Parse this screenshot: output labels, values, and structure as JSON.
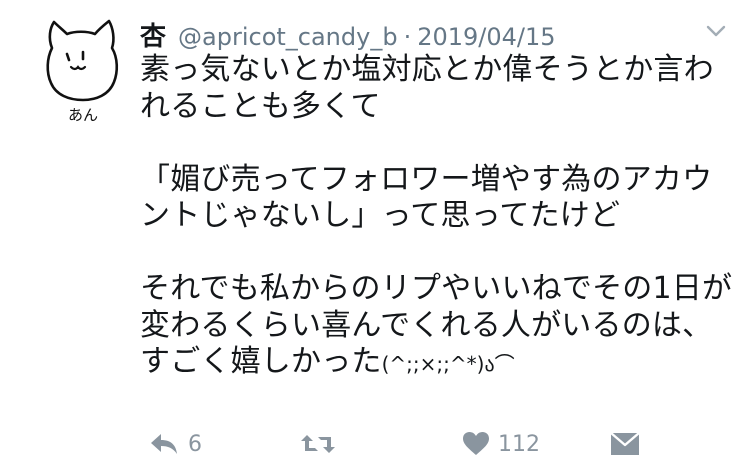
{
  "tweet": {
    "avatar_caption": "あん",
    "display_name": "杏",
    "handle": "@apricot_candy_b",
    "separator": "·",
    "date": "2019/04/15",
    "lines": [
      "素っ気ないとか塩対応とか偉そうとか言わ",
      "れることも多くて",
      "",
      "「媚び売ってフォロワー増やす為のアカウ",
      "ントじゃないし」って思ってたけど",
      "",
      "それでも私からのリプやいいねでその1日が",
      "変わるくらい喜んでくれる人がいるのは、"
    ],
    "last_line_text": "すごく嬉しかった",
    "kaomoji": "(^;;×;;^*)ა⌒",
    "reply_count": "6",
    "like_count": "112"
  },
  "colors": {
    "text": "#14171a",
    "secondary": "#657786",
    "action_gray": "#8a959f"
  },
  "icons": {
    "caret": "chevron-down-icon",
    "reply": "reply-icon",
    "retweet": "retweet-icon",
    "like": "heart-icon",
    "dm": "envelope-icon"
  }
}
